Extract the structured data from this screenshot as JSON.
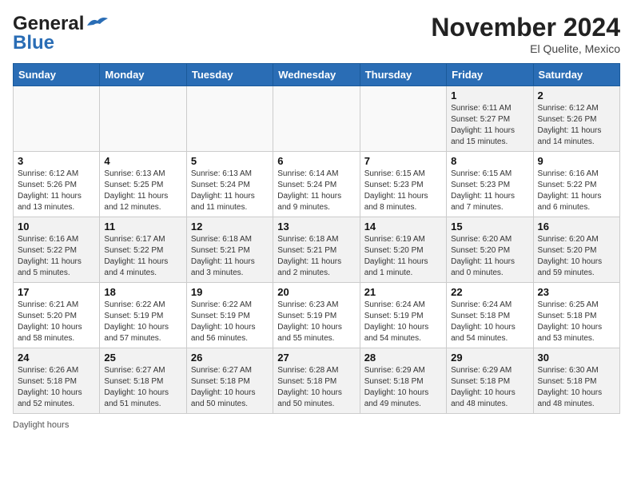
{
  "header": {
    "logo_line1": "General",
    "logo_line2": "Blue",
    "month": "November 2024",
    "location": "El Quelite, Mexico"
  },
  "days_of_week": [
    "Sunday",
    "Monday",
    "Tuesday",
    "Wednesday",
    "Thursday",
    "Friday",
    "Saturday"
  ],
  "weeks": [
    [
      {
        "day": "",
        "info": ""
      },
      {
        "day": "",
        "info": ""
      },
      {
        "day": "",
        "info": ""
      },
      {
        "day": "",
        "info": ""
      },
      {
        "day": "",
        "info": ""
      },
      {
        "day": "1",
        "info": "Sunrise: 6:11 AM\nSunset: 5:27 PM\nDaylight: 11 hours and 15 minutes."
      },
      {
        "day": "2",
        "info": "Sunrise: 6:12 AM\nSunset: 5:26 PM\nDaylight: 11 hours and 14 minutes."
      }
    ],
    [
      {
        "day": "3",
        "info": "Sunrise: 6:12 AM\nSunset: 5:26 PM\nDaylight: 11 hours and 13 minutes."
      },
      {
        "day": "4",
        "info": "Sunrise: 6:13 AM\nSunset: 5:25 PM\nDaylight: 11 hours and 12 minutes."
      },
      {
        "day": "5",
        "info": "Sunrise: 6:13 AM\nSunset: 5:24 PM\nDaylight: 11 hours and 11 minutes."
      },
      {
        "day": "6",
        "info": "Sunrise: 6:14 AM\nSunset: 5:24 PM\nDaylight: 11 hours and 9 minutes."
      },
      {
        "day": "7",
        "info": "Sunrise: 6:15 AM\nSunset: 5:23 PM\nDaylight: 11 hours and 8 minutes."
      },
      {
        "day": "8",
        "info": "Sunrise: 6:15 AM\nSunset: 5:23 PM\nDaylight: 11 hours and 7 minutes."
      },
      {
        "day": "9",
        "info": "Sunrise: 6:16 AM\nSunset: 5:22 PM\nDaylight: 11 hours and 6 minutes."
      }
    ],
    [
      {
        "day": "10",
        "info": "Sunrise: 6:16 AM\nSunset: 5:22 PM\nDaylight: 11 hours and 5 minutes."
      },
      {
        "day": "11",
        "info": "Sunrise: 6:17 AM\nSunset: 5:22 PM\nDaylight: 11 hours and 4 minutes."
      },
      {
        "day": "12",
        "info": "Sunrise: 6:18 AM\nSunset: 5:21 PM\nDaylight: 11 hours and 3 minutes."
      },
      {
        "day": "13",
        "info": "Sunrise: 6:18 AM\nSunset: 5:21 PM\nDaylight: 11 hours and 2 minutes."
      },
      {
        "day": "14",
        "info": "Sunrise: 6:19 AM\nSunset: 5:20 PM\nDaylight: 11 hours and 1 minute."
      },
      {
        "day": "15",
        "info": "Sunrise: 6:20 AM\nSunset: 5:20 PM\nDaylight: 11 hours and 0 minutes."
      },
      {
        "day": "16",
        "info": "Sunrise: 6:20 AM\nSunset: 5:20 PM\nDaylight: 10 hours and 59 minutes."
      }
    ],
    [
      {
        "day": "17",
        "info": "Sunrise: 6:21 AM\nSunset: 5:20 PM\nDaylight: 10 hours and 58 minutes."
      },
      {
        "day": "18",
        "info": "Sunrise: 6:22 AM\nSunset: 5:19 PM\nDaylight: 10 hours and 57 minutes."
      },
      {
        "day": "19",
        "info": "Sunrise: 6:22 AM\nSunset: 5:19 PM\nDaylight: 10 hours and 56 minutes."
      },
      {
        "day": "20",
        "info": "Sunrise: 6:23 AM\nSunset: 5:19 PM\nDaylight: 10 hours and 55 minutes."
      },
      {
        "day": "21",
        "info": "Sunrise: 6:24 AM\nSunset: 5:19 PM\nDaylight: 10 hours and 54 minutes."
      },
      {
        "day": "22",
        "info": "Sunrise: 6:24 AM\nSunset: 5:18 PM\nDaylight: 10 hours and 54 minutes."
      },
      {
        "day": "23",
        "info": "Sunrise: 6:25 AM\nSunset: 5:18 PM\nDaylight: 10 hours and 53 minutes."
      }
    ],
    [
      {
        "day": "24",
        "info": "Sunrise: 6:26 AM\nSunset: 5:18 PM\nDaylight: 10 hours and 52 minutes."
      },
      {
        "day": "25",
        "info": "Sunrise: 6:27 AM\nSunset: 5:18 PM\nDaylight: 10 hours and 51 minutes."
      },
      {
        "day": "26",
        "info": "Sunrise: 6:27 AM\nSunset: 5:18 PM\nDaylight: 10 hours and 50 minutes."
      },
      {
        "day": "27",
        "info": "Sunrise: 6:28 AM\nSunset: 5:18 PM\nDaylight: 10 hours and 50 minutes."
      },
      {
        "day": "28",
        "info": "Sunrise: 6:29 AM\nSunset: 5:18 PM\nDaylight: 10 hours and 49 minutes."
      },
      {
        "day": "29",
        "info": "Sunrise: 6:29 AM\nSunset: 5:18 PM\nDaylight: 10 hours and 48 minutes."
      },
      {
        "day": "30",
        "info": "Sunrise: 6:30 AM\nSunset: 5:18 PM\nDaylight: 10 hours and 48 minutes."
      }
    ]
  ],
  "footer": {
    "label": "Daylight hours"
  }
}
